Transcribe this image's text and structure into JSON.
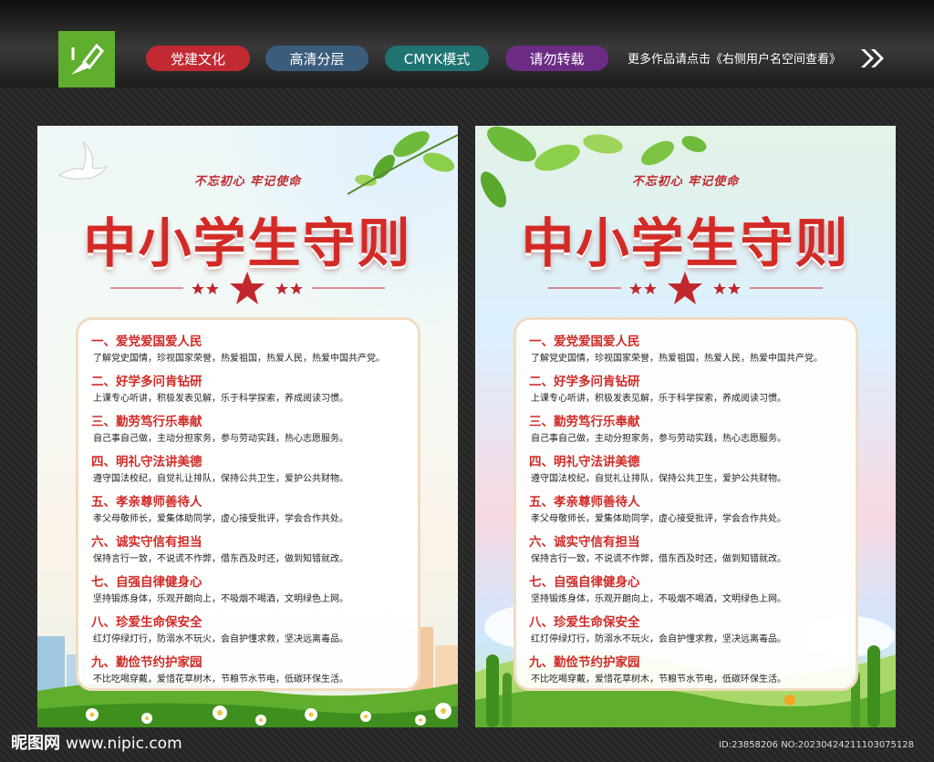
{
  "tags": [
    "党建文化",
    "高清分层",
    "CMYK模式",
    "请勿转载"
  ],
  "more_text": "更多作品请点击《右侧用户名空间查看》",
  "slogan": "不忘初心 牢记使命",
  "title": "中小学生守则",
  "rules": [
    {
      "heading": "一、爱党爱国爱人民",
      "text": "了解党史国情，珍视国家荣誉，热爱祖国，热爱人民，热爱中国共产党。"
    },
    {
      "heading": "二、好学多问肯钻研",
      "text": "上课专心听讲，积极发表见解，乐于科学探索，养成阅读习惯。"
    },
    {
      "heading": "三、勤劳笃行乐奉献",
      "text": "自己事自己做，主动分担家务，参与劳动实践，热心志愿服务。"
    },
    {
      "heading": "四、明礼守法讲美德",
      "text": "遵守国法校纪，自觉礼让排队，保持公共卫生，爱护公共财物。"
    },
    {
      "heading": "五、孝亲尊师善待人",
      "text": "孝父母敬师长，爱集体助同学，虚心接受批评，学会合作共处。"
    },
    {
      "heading": "六、诚实守信有担当",
      "text": "保持言行一致，不说谎不作弊，借东西及时还，做到知错就改。"
    },
    {
      "heading": "七、自强自律健身心",
      "text": "坚持锻炼身体，乐观开朗向上，不吸烟不喝酒，文明绿色上网。"
    },
    {
      "heading": "八、珍爱生命保安全",
      "text": "红灯停绿灯行，防溺水不玩火，会自护懂求救，坚决远离毒品。"
    },
    {
      "heading": "九、勤俭节约护家园",
      "text": "不比吃喝穿戴，爱惜花草树木，节粮节水节电，低碳环保生活。"
    }
  ],
  "footer_site": "昵图网",
  "footer_url": "www.nipic.com",
  "footer_id": "ID:23858206 NO:20230424211103075128",
  "colors": {
    "accent_red": "#d42a26",
    "pill_red": "#c12a33",
    "pill_blue": "#3b5d7c",
    "pill_teal": "#1f7471",
    "pill_purple": "#6c2c86"
  }
}
